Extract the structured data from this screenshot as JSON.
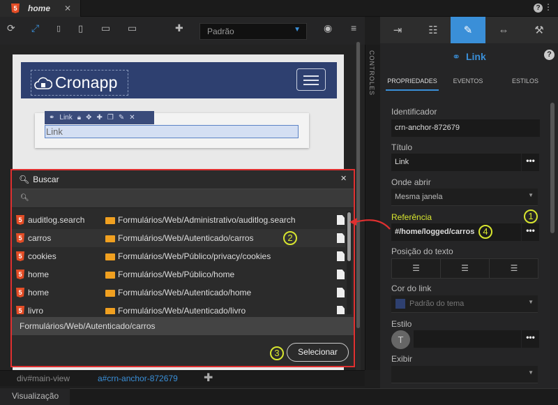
{
  "tab": {
    "title": "home",
    "close": "✕"
  },
  "top_icons": {
    "help": "?",
    "menu": "⋮"
  },
  "toolbar": {
    "device_select": "Padrão",
    "add": "✚"
  },
  "canvas": {
    "logo_text": "Cronapp",
    "link_toolbar_label": "Link",
    "link_text": "Link"
  },
  "controles": "CONTROLES",
  "right_panel": {
    "title": "Link",
    "help": "?",
    "subtabs": [
      "PROPRIEDADES",
      "EVENTOS",
      "ESTILOS"
    ],
    "fields": {
      "identificador_label": "Identificador",
      "identificador_value": "crn-anchor-872679",
      "titulo_label": "Título",
      "titulo_value": "Link",
      "onde_abrir_label": "Onde abrir",
      "onde_abrir_value": "Mesma janela",
      "referencia_label": "Referência",
      "referencia_value": "#/home/logged/carros",
      "posicao_label": "Posição do texto",
      "cor_label": "Cor do link",
      "cor_value": "Padrão do tema",
      "estilo_label": "Estilo",
      "avatar_letter": "T",
      "exibir_label": "Exibir",
      "dots": "•••"
    }
  },
  "modal": {
    "title": "Buscar",
    "close": "✕",
    "results": [
      {
        "name": "auditlog.search",
        "path": "Formulários/Web/Administrativo/auditlog.search"
      },
      {
        "name": "carros",
        "path": "Formulários/Web/Autenticado/carros"
      },
      {
        "name": "cookies",
        "path": "Formulários/Web/Público/privacy/cookies"
      },
      {
        "name": "home",
        "path": "Formulários/Web/Público/home"
      },
      {
        "name": "home",
        "path": "Formulários/Web/Autenticado/home"
      },
      {
        "name": "livro",
        "path": "Formulários/Web/Autenticado/livro"
      }
    ],
    "selected_path": "Formulários/Web/Autenticado/carros",
    "select_button": "Selecionar"
  },
  "badges": [
    "1",
    "2",
    "3",
    "4"
  ],
  "breadcrumb": {
    "item1": "div#main-view",
    "item2": "a#crn-anchor-872679"
  },
  "bottom": {
    "visualizacao": "Visualização"
  },
  "colors": {
    "accent": "#3a8fd8",
    "modal_border": "#e03030",
    "badge": "#d8e62f",
    "navbar": "#2e4070"
  }
}
